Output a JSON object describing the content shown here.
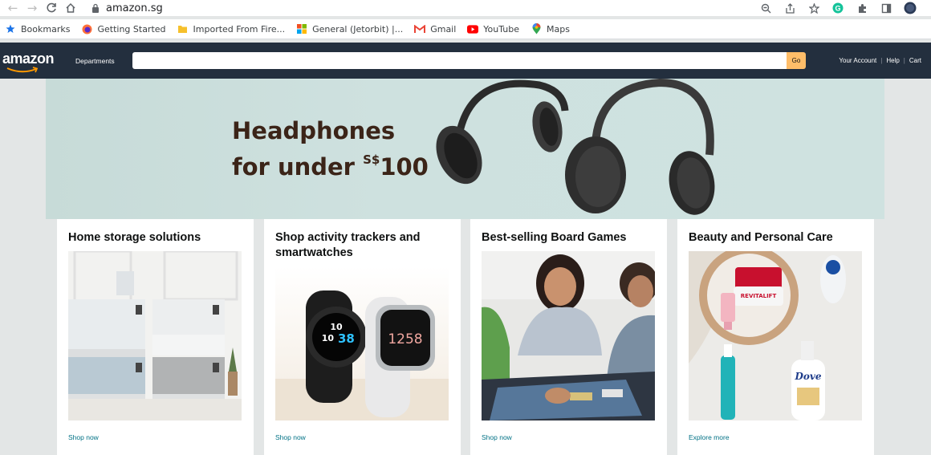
{
  "browser": {
    "url": "amazon.sg",
    "bookmarks": [
      {
        "label": "Bookmarks",
        "icon": "star-icon"
      },
      {
        "label": "Getting Started",
        "icon": "firefox-icon"
      },
      {
        "label": "Imported From Fire...",
        "icon": "folder-icon"
      },
      {
        "label": "General (Jetorbit) |...",
        "icon": "windows-icon"
      },
      {
        "label": "Gmail",
        "icon": "gmail-icon"
      },
      {
        "label": "YouTube",
        "icon": "youtube-icon"
      },
      {
        "label": "Maps",
        "icon": "maps-icon"
      }
    ]
  },
  "nav": {
    "logo": "amazon",
    "departments": "Departments",
    "search_value": "",
    "go_label": "Go",
    "links": [
      "Your Account",
      "Help",
      "Cart"
    ]
  },
  "hero": {
    "line1": "Headphones",
    "line2_prefix": "for under ",
    "currency": "S$",
    "price": "100"
  },
  "cards": [
    {
      "title": "Home storage solutions",
      "link": "Shop now"
    },
    {
      "title": "Shop activity trackers and smartwatches",
      "link": "Shop now"
    },
    {
      "title": "Best-selling Board Games",
      "link": "Shop now"
    },
    {
      "title": "Beauty and Personal Care",
      "link": "Explore more"
    }
  ],
  "card_images": {
    "watch1_time_a": "10",
    "watch1_time_b": "10",
    "watch1_time_c": "38",
    "watch2_time": "1258",
    "product_revitalift": "REVITALIFT",
    "product_dove": "Dove"
  },
  "colors": {
    "nav_bg": "#232f3e",
    "go_button": "#febd69",
    "link": "#007185",
    "page_bg": "#e3e6e6"
  }
}
